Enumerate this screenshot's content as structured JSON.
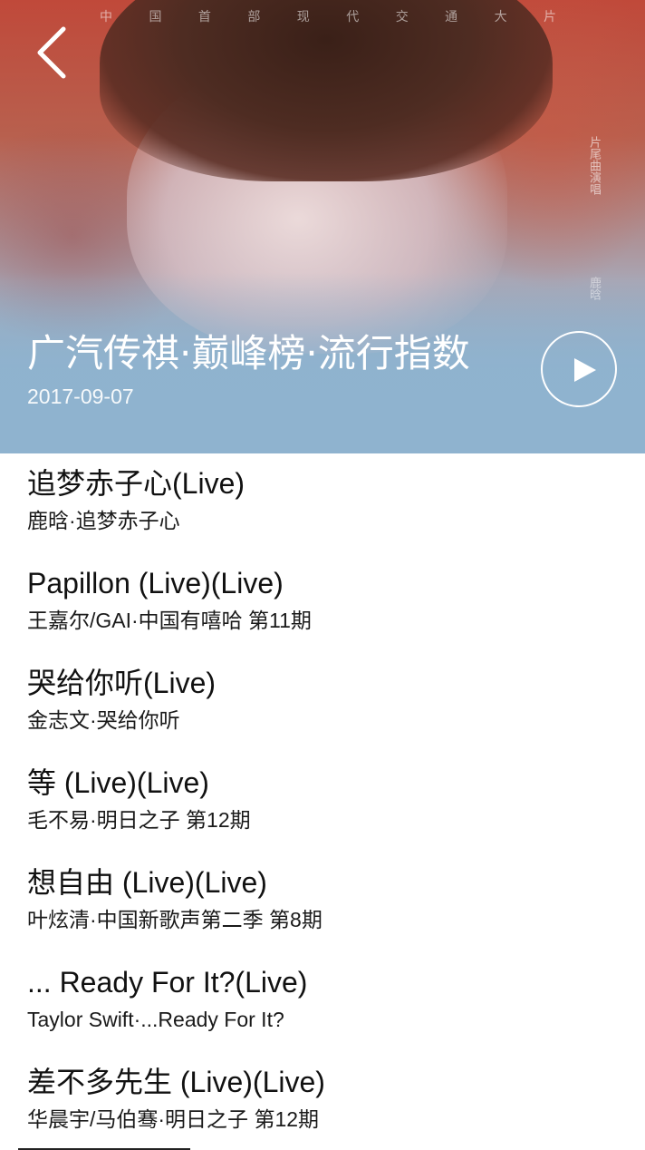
{
  "header": {
    "poster_caption": "中 国 首 部 现 代 交 通 大 片",
    "poster_side_text": "片尾曲演唱",
    "poster_side_text_2": "鹿晗",
    "title": "广汽传祺·巅峰榜·流行指数",
    "date": "2017-09-07",
    "back_icon": "chevron-left-icon",
    "play_icon": "play-icon"
  },
  "tracks": [
    {
      "title": "追梦赤子心(Live)",
      "subtitle": "鹿晗·追梦赤子心"
    },
    {
      "title": "Papillon (Live)(Live)",
      "subtitle": "王嘉尔/GAI·中国有嘻哈 第11期"
    },
    {
      "title": "哭给你听(Live)",
      "subtitle": "金志文·哭给你听"
    },
    {
      "title": "等 (Live)(Live)",
      "subtitle": "毛不易·明日之子 第12期"
    },
    {
      "title": "想自由 (Live)(Live)",
      "subtitle": "叶炫清·中国新歌声第二季 第8期"
    },
    {
      "title": "... Ready For It?(Live)",
      "subtitle": "Taylor Swift·...Ready For It?"
    },
    {
      "title": "差不多先生 (Live)(Live)",
      "subtitle": "华晨宇/马伯骞·明日之子 第12期"
    }
  ],
  "colors": {
    "header_top": "#c0493a",
    "header_bottom": "#8fb3cf",
    "text_primary": "#111111",
    "background": "#ffffff"
  }
}
